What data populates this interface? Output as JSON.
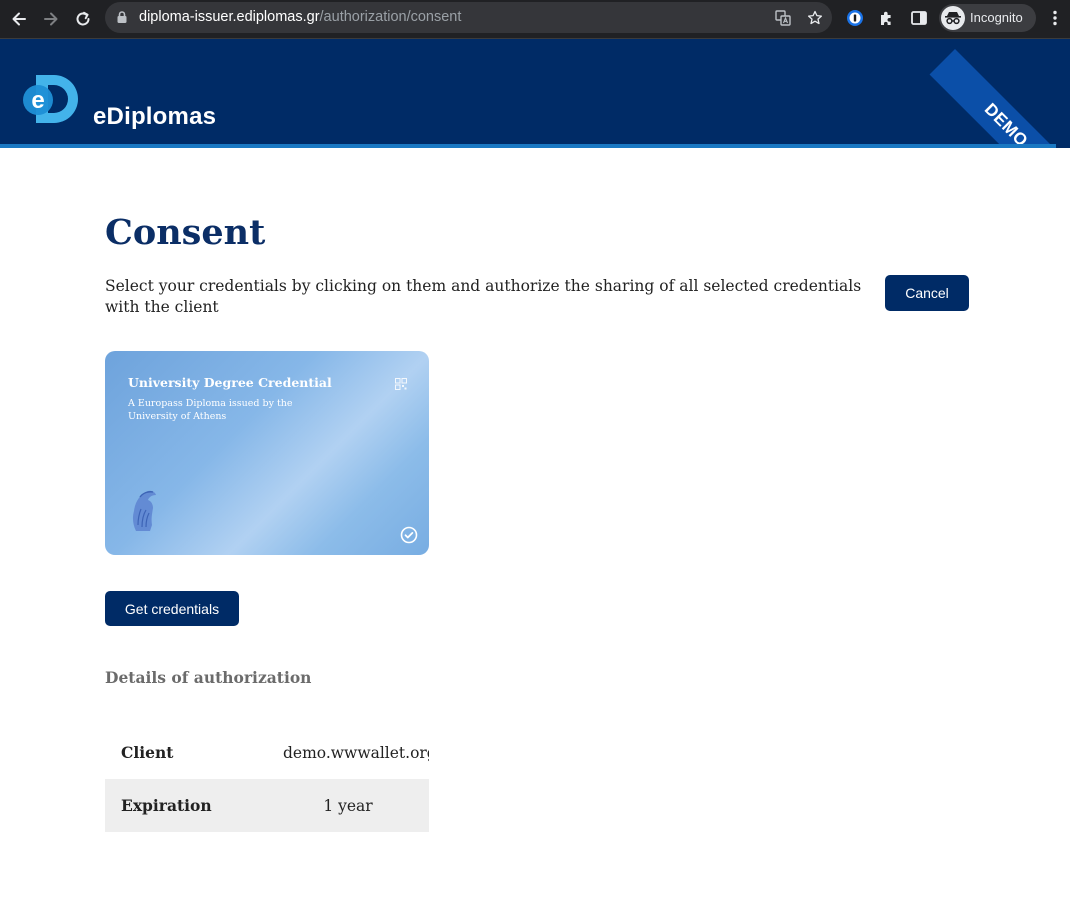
{
  "browser": {
    "url_host": "diploma-issuer.ediplomas.gr",
    "url_path": "/authorization/consent",
    "profile_label": "Incognito"
  },
  "site": {
    "logo_text": "eDiplomas",
    "logo_initial": "e",
    "ribbon": "DEMO"
  },
  "page": {
    "title": "Consent",
    "instructions": "Select your credentials by clicking on them and authorize the sharing of all selected credentials with the client",
    "cancel_label": "Cancel",
    "get_credentials_label": "Get credentials"
  },
  "credential_card": {
    "title": "University Degree Credential",
    "subtitle": "A Europass Diploma issued by the University of Athens",
    "selected": true
  },
  "details": {
    "heading": "Details of authorization",
    "rows": [
      {
        "key": "Client",
        "value": "demo.wwwallet.org"
      },
      {
        "key": "Expiration",
        "value": "1 year"
      }
    ]
  },
  "colors": {
    "header_bg": "#002b66",
    "accent": "#1a78c2",
    "title": "#0b2e66",
    "button": "#002b66"
  }
}
